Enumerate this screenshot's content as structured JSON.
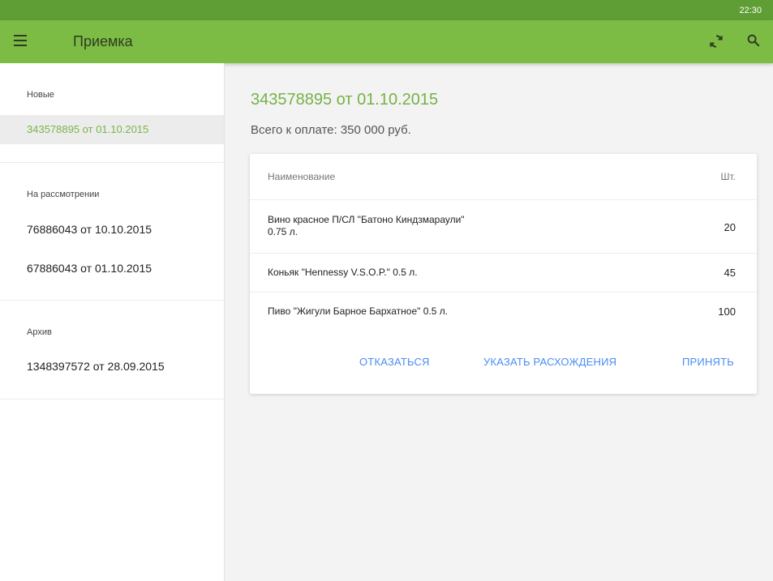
{
  "status_bar": {
    "time": "22:30"
  },
  "app_bar": {
    "title": "Приемка",
    "menu_icon": "menu-icon",
    "refresh_icon": "sync-icon",
    "search_icon": "search-icon",
    "color": "#7cbc44"
  },
  "sidebar": {
    "sections": [
      {
        "title": "Новые",
        "items": [
          {
            "label": "343578895 от 01.10.2015",
            "selected": true
          }
        ]
      },
      {
        "title": "На рассмотрении",
        "items": [
          {
            "label": "76886043 от 10.10.2015"
          },
          {
            "label": "67886043 от 01.10.2015"
          }
        ]
      },
      {
        "title": "Архив",
        "items": [
          {
            "label": "1348397572 от 28.09.2015"
          }
        ]
      }
    ]
  },
  "document": {
    "title": "343578895 от 01.10.2015",
    "total": "Всего к оплате: 350 000 руб.",
    "table": {
      "headers": {
        "name": "Наименование",
        "qty": "Шт."
      },
      "rows": [
        {
          "name": "Вино красное П/СЛ \"Батоно Киндзмараули\" 0.75 л.",
          "qty": "20"
        },
        {
          "name": "Коньяк \"Hennessy V.S.O.P.\" 0.5 л.",
          "qty": "45"
        },
        {
          "name": "Пиво \"Жигули Барное Бархатное\" 0.5 л.",
          "qty": "100"
        }
      ]
    },
    "actions": {
      "reject": "ОТКАЗАТЬСЯ",
      "discrepancy": "УКАЗАТЬ РАСХОЖДЕНИЯ",
      "accept": "ПРИНЯТЬ"
    }
  },
  "colors": {
    "accent": "#76b248",
    "link": "#4a8df2",
    "status_bar": "#5e9e35"
  }
}
